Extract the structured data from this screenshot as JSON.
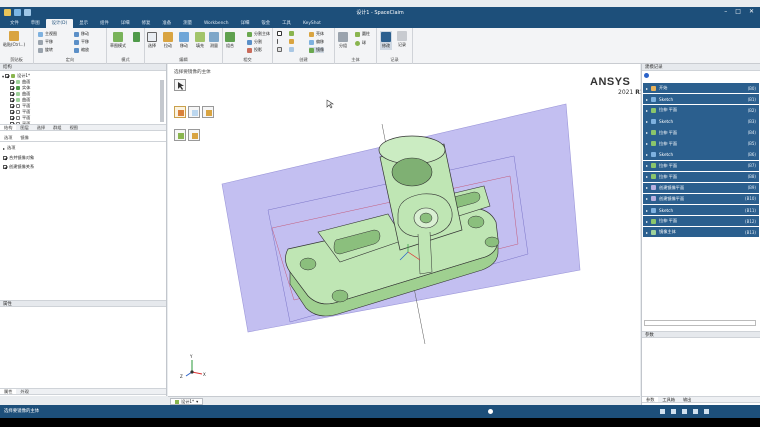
{
  "window": {
    "title": "设计1 - SpaceClaim"
  },
  "menu": {
    "tabs": [
      "文件",
      "草图",
      "设计(D)",
      "显示",
      "组件",
      "详细",
      "修复",
      "准备",
      "测量",
      "Workbench",
      "详细",
      "钣金",
      "工具",
      "KeyShot"
    ],
    "active_index": 2
  },
  "ribbon": {
    "groups": [
      {
        "name": "剪贴板"
      },
      {
        "name": "定向"
      },
      {
        "name": "模式"
      },
      {
        "name": "编辑"
      },
      {
        "name": "相交"
      },
      {
        "name": "创建"
      },
      {
        "name": "主体"
      },
      {
        "name": "记录"
      }
    ],
    "clipboard": {
      "paste": "粘贴(Ctrl...)"
    },
    "orient": {
      "items": [
        "主视图",
        "平移",
        "旋转"
      ],
      "right_items": [
        "移动",
        "平移",
        "缩放"
      ]
    },
    "mode": {
      "sketch": "草图模式"
    },
    "edit": {
      "select": "选择",
      "pull": "拉动",
      "move": "移动",
      "fill": "填充",
      "measure": "测量"
    },
    "intersect": {
      "combine": "组合",
      "split_body": "分割主体",
      "split": "分割",
      "project": "投影"
    },
    "create": {
      "items": [
        "圆柱",
        "圆柱",
        "壳体",
        "偏移",
        "镜像"
      ]
    },
    "body": {
      "items": [
        "分组",
        "相交",
        "圆柱",
        "球"
      ]
    },
    "record": {
      "items": [
        "修改",
        "记录"
      ]
    }
  },
  "left_panel": {
    "structure_title": "结构",
    "tree": [
      {
        "label": "设计1*",
        "checked": true,
        "level": 0
      },
      {
        "label": "曲面",
        "checked": true,
        "level": 1
      },
      {
        "label": "实体",
        "checked": true,
        "level": 1
      },
      {
        "label": "曲面",
        "checked": true,
        "level": 1
      },
      {
        "label": "曲面",
        "checked": true,
        "level": 1
      },
      {
        "label": "平面",
        "checked": false,
        "level": 1
      },
      {
        "label": "平面",
        "checked": false,
        "level": 1
      },
      {
        "label": "平面",
        "checked": false,
        "level": 1
      },
      {
        "label": "平面",
        "checked": false,
        "level": 1
      }
    ],
    "subtabs": [
      "结构",
      "图层",
      "选择",
      "群组",
      "视图"
    ],
    "options_tabs": [
      "选项",
      "镜像"
    ],
    "options": {
      "header": "选项",
      "items": [
        {
          "label": "合并镜像对象",
          "checked": true
        },
        {
          "label": "创建镜像关系",
          "checked": true
        }
      ]
    },
    "properties_title": "属性",
    "bottom_tabs": [
      "属性",
      "外观"
    ]
  },
  "viewport": {
    "hint": "选择要镜像的主体",
    "brand": "ANSYS",
    "version_prefix": "2021",
    "version_suffix": "R1",
    "view_tab": "设计1*",
    "triad": {
      "x": "X",
      "y": "Y",
      "z": "Z"
    }
  },
  "right_panel": {
    "title": "建模记录",
    "history": [
      {
        "label": "开始",
        "code": "(B0)",
        "color": "#e8b25b"
      },
      {
        "label": "Sketch",
        "code": "(B1)",
        "color": "#7eb1df"
      },
      {
        "label": "拉伸 平面",
        "code": "(B2)",
        "color": "#8bc56b"
      },
      {
        "label": "Sketch",
        "code": "(B3)",
        "color": "#7eb1df"
      },
      {
        "label": "拉伸 平面",
        "code": "(B4)",
        "color": "#8bc56b"
      },
      {
        "label": "拉伸 平面",
        "code": "(B5)",
        "color": "#8bc56b"
      },
      {
        "label": "Sketch",
        "code": "(B6)",
        "color": "#7eb1df"
      },
      {
        "label": "拉伸 平面",
        "code": "(B7)",
        "color": "#8bc56b"
      },
      {
        "label": "拉伸 平面",
        "code": "(B8)",
        "color": "#8bc56b"
      },
      {
        "label": "创建镜像平面",
        "code": "(B9)",
        "color": "#b8b0e0"
      },
      {
        "label": "创建镜像平面",
        "code": "(B10)",
        "color": "#b8b0e0"
      },
      {
        "label": "Sketch",
        "code": "(B11)",
        "color": "#7eb1df"
      },
      {
        "label": "拉伸 平面",
        "code": "(B12)",
        "color": "#8bc56b"
      },
      {
        "label": "镜像主体",
        "code": "(B13)",
        "color": "#9fd29b"
      }
    ],
    "params_title": "参数",
    "bottom_tabs": [
      "参数",
      "工具箱",
      "输出"
    ]
  },
  "status": {
    "message": "选择要镜像的主体"
  },
  "colors": {
    "ribbon_blue": "#1d4f7a",
    "history_row": "#2b5f8e",
    "plane": "#b9b4ee",
    "body": "#bfe6b4"
  }
}
